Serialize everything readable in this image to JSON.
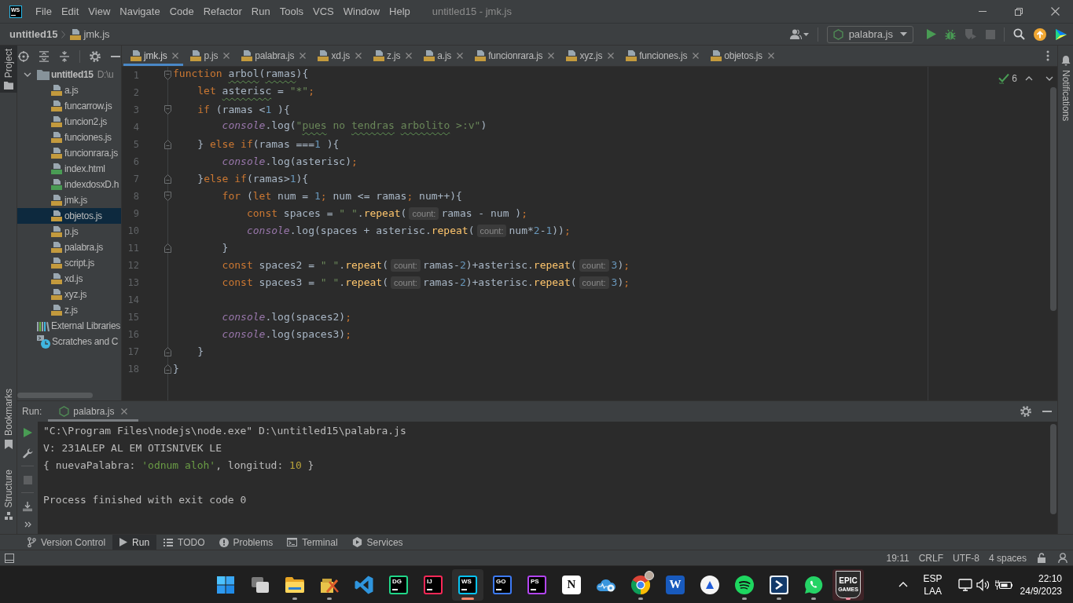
{
  "window": {
    "logo": "WS",
    "menu": [
      "File",
      "Edit",
      "View",
      "Navigate",
      "Code",
      "Refactor",
      "Run",
      "Tools",
      "VCS",
      "Window",
      "Help"
    ],
    "title": "untitled15 - jmk.js"
  },
  "navigation_bar": {
    "breadcrumbs": [
      {
        "label": "untitled15",
        "kind": "project"
      },
      {
        "label": "jmk.js",
        "kind": "js"
      }
    ],
    "run_configuration": "palabra.js"
  },
  "left_stripe": {
    "top": [
      {
        "label": "Project",
        "kind": "folder",
        "selected": true
      }
    ],
    "bottom": [
      {
        "label": "Bookmarks",
        "kind": "bookmark",
        "selected": false
      },
      {
        "label": "Structure",
        "kind": "structure",
        "selected": false
      }
    ]
  },
  "project_tree": [
    {
      "label": "untitled15",
      "path": "D:\\u",
      "kind": "folder",
      "expanded": true,
      "selected": false,
      "children": [
        {
          "label": "a.js",
          "kind": "js",
          "selected": false
        },
        {
          "label": "funcarrow.js",
          "kind": "js",
          "selected": false
        },
        {
          "label": "funcion2.js",
          "kind": "js",
          "selected": false
        },
        {
          "label": "funciones.js",
          "kind": "js",
          "selected": false
        },
        {
          "label": "funcionrara.js",
          "kind": "js",
          "selected": false
        },
        {
          "label": "index.html",
          "kind": "html",
          "selected": false
        },
        {
          "label": "indexdosxD.h",
          "kind": "html",
          "selected": false
        },
        {
          "label": "jmk.js",
          "kind": "js",
          "selected": false
        },
        {
          "label": "objetos.js",
          "kind": "js",
          "selected": true
        },
        {
          "label": "p.js",
          "kind": "js",
          "selected": false
        },
        {
          "label": "palabra.js",
          "kind": "js",
          "selected": false
        },
        {
          "label": "script.js",
          "kind": "js",
          "selected": false
        },
        {
          "label": "xd.js",
          "kind": "js",
          "selected": false
        },
        {
          "label": "xyz.js",
          "kind": "js",
          "selected": false
        },
        {
          "label": "z.js",
          "kind": "js",
          "selected": false
        }
      ]
    },
    {
      "label": "External Libraries",
      "kind": "libraries",
      "selected": false
    },
    {
      "label": "Scratches and C",
      "kind": "scratches",
      "selected": false
    }
  ],
  "editor_tabs": [
    {
      "label": "jmk.js",
      "selected": true
    },
    {
      "label": "p.js",
      "selected": false
    },
    {
      "label": "palabra.js",
      "selected": false
    },
    {
      "label": "xd.js",
      "selected": false
    },
    {
      "label": "z.js",
      "selected": false
    },
    {
      "label": "a.js",
      "selected": false
    },
    {
      "label": "funcionrara.js",
      "selected": false
    },
    {
      "label": "xyz.js",
      "selected": false
    },
    {
      "label": "funciones.js",
      "selected": false
    },
    {
      "label": "objetos.js",
      "selected": false
    }
  ],
  "editor": {
    "inspection_count": "6",
    "lines": [
      {
        "number": "1",
        "fold_start": true,
        "tokens": [
          {
            "kind": "keyword",
            "text": "function "
          },
          {
            "kind": "plain",
            "text": "arbol",
            "typo": true
          },
          {
            "kind": "plain",
            "text": "("
          },
          {
            "kind": "plain",
            "text": "ramas",
            "typo": true
          },
          {
            "kind": "plain",
            "text": "){"
          }
        ]
      },
      {
        "number": "2",
        "tokens": [
          {
            "kind": "keyword",
            "text": "    let "
          },
          {
            "kind": "plain",
            "text": "asterisc",
            "typo": true
          },
          {
            "kind": "plain",
            "text": " = "
          },
          {
            "kind": "string",
            "text": "\"*\""
          },
          {
            "kind": "keyword",
            "text": ";"
          }
        ]
      },
      {
        "number": "3",
        "fold_start": true,
        "tokens": [
          {
            "kind": "keyword",
            "text": "    if"
          },
          {
            "kind": "plain",
            "text": " (ramas <"
          },
          {
            "kind": "number",
            "text": "1"
          },
          {
            "kind": "plain",
            "text": " ){"
          }
        ]
      },
      {
        "number": "4",
        "tokens": [
          {
            "kind": "object",
            "text": "        console"
          },
          {
            "kind": "plain",
            "text": ".log("
          },
          {
            "kind": "string",
            "text": "\""
          },
          {
            "kind": "string",
            "text": "pues",
            "typo": true
          },
          {
            "kind": "string",
            "text": " no "
          },
          {
            "kind": "string",
            "text": "tendras ",
            "typo": true
          },
          {
            "kind": "string",
            "text": "arbolito",
            "typo": true
          },
          {
            "kind": "string",
            "text": " >:v\""
          },
          {
            "kind": "plain",
            "text": ")"
          }
        ]
      },
      {
        "number": "5",
        "fold_end": true,
        "tokens": [
          {
            "kind": "plain",
            "text": "    } "
          },
          {
            "kind": "keyword",
            "text": "else if"
          },
          {
            "kind": "plain",
            "text": "(ramas ==="
          },
          {
            "kind": "number",
            "text": "1"
          },
          {
            "kind": "plain",
            "text": " ){"
          }
        ]
      },
      {
        "number": "6",
        "tokens": [
          {
            "kind": "object",
            "text": "        console"
          },
          {
            "kind": "plain",
            "text": ".log(asterisc)"
          },
          {
            "kind": "keyword",
            "text": ";"
          }
        ]
      },
      {
        "number": "7",
        "fold_end": true,
        "tokens": [
          {
            "kind": "plain",
            "text": "    }"
          },
          {
            "kind": "keyword",
            "text": "else if"
          },
          {
            "kind": "plain",
            "text": "(ramas>"
          },
          {
            "kind": "number",
            "text": "1"
          },
          {
            "kind": "plain",
            "text": "){"
          }
        ]
      },
      {
        "number": "8",
        "fold_start": true,
        "tokens": [
          {
            "kind": "keyword",
            "text": "        for"
          },
          {
            "kind": "plain",
            "text": " ("
          },
          {
            "kind": "keyword",
            "text": "let"
          },
          {
            "kind": "plain",
            "text": " num = "
          },
          {
            "kind": "number",
            "text": "1"
          },
          {
            "kind": "keyword",
            "text": ";"
          },
          {
            "kind": "plain",
            "text": " num <= ramas"
          },
          {
            "kind": "keyword",
            "text": ";"
          },
          {
            "kind": "plain",
            "text": " num++){"
          }
        ]
      },
      {
        "number": "9",
        "tokens": [
          {
            "kind": "keyword",
            "text": "            const"
          },
          {
            "kind": "plain",
            "text": " spaces = "
          },
          {
            "kind": "string",
            "text": "\" \""
          },
          {
            "kind": "plain",
            "text": "."
          },
          {
            "kind": "method",
            "text": "repeat"
          },
          {
            "kind": "plain",
            "text": "("
          },
          {
            "kind": "hint",
            "text": "count:"
          },
          {
            "kind": "plain",
            "text": "ramas - num )"
          },
          {
            "kind": "keyword",
            "text": ";"
          }
        ]
      },
      {
        "number": "10",
        "tokens": [
          {
            "kind": "object",
            "text": "            console"
          },
          {
            "kind": "plain",
            "text": ".log(spaces + asterisc."
          },
          {
            "kind": "method",
            "text": "repeat"
          },
          {
            "kind": "plain",
            "text": "("
          },
          {
            "kind": "hint",
            "text": "count:"
          },
          {
            "kind": "plain",
            "text": "num*"
          },
          {
            "kind": "number",
            "text": "2"
          },
          {
            "kind": "plain",
            "text": "-"
          },
          {
            "kind": "number",
            "text": "1"
          },
          {
            "kind": "plain",
            "text": "))"
          },
          {
            "kind": "keyword",
            "text": ";"
          }
        ]
      },
      {
        "number": "11",
        "fold_end": true,
        "tokens": [
          {
            "kind": "plain",
            "text": "        }"
          }
        ]
      },
      {
        "number": "12",
        "tokens": [
          {
            "kind": "keyword",
            "text": "        const"
          },
          {
            "kind": "plain",
            "text": " spaces2 = "
          },
          {
            "kind": "string",
            "text": "\" \""
          },
          {
            "kind": "plain",
            "text": "."
          },
          {
            "kind": "method",
            "text": "repeat"
          },
          {
            "kind": "plain",
            "text": "("
          },
          {
            "kind": "hint",
            "text": "count:"
          },
          {
            "kind": "plain",
            "text": "ramas-"
          },
          {
            "kind": "number",
            "text": "2"
          },
          {
            "kind": "plain",
            "text": ")+asterisc."
          },
          {
            "kind": "method",
            "text": "repeat"
          },
          {
            "kind": "plain",
            "text": "("
          },
          {
            "kind": "hint",
            "text": "count:"
          },
          {
            "kind": "number",
            "text": "3"
          },
          {
            "kind": "plain",
            "text": ")"
          },
          {
            "kind": "keyword",
            "text": ";"
          }
        ]
      },
      {
        "number": "13",
        "tokens": [
          {
            "kind": "keyword",
            "text": "        const"
          },
          {
            "kind": "plain",
            "text": " spaces3 = "
          },
          {
            "kind": "string",
            "text": "\" \""
          },
          {
            "kind": "plain",
            "text": "."
          },
          {
            "kind": "method",
            "text": "repeat"
          },
          {
            "kind": "plain",
            "text": "("
          },
          {
            "kind": "hint",
            "text": "count:"
          },
          {
            "kind": "plain",
            "text": "ramas-"
          },
          {
            "kind": "number",
            "text": "2"
          },
          {
            "kind": "plain",
            "text": ")+asterisc."
          },
          {
            "kind": "method",
            "text": "repeat"
          },
          {
            "kind": "plain",
            "text": "("
          },
          {
            "kind": "hint",
            "text": "count:"
          },
          {
            "kind": "number",
            "text": "3"
          },
          {
            "kind": "plain",
            "text": ")"
          },
          {
            "kind": "keyword",
            "text": ";"
          }
        ]
      },
      {
        "number": "14"
      },
      {
        "number": "15",
        "tokens": [
          {
            "kind": "object",
            "text": "        console"
          },
          {
            "kind": "plain",
            "text": ".log(spaces2)"
          },
          {
            "kind": "keyword",
            "text": ";"
          }
        ]
      },
      {
        "number": "16",
        "tokens": [
          {
            "kind": "object",
            "text": "        console"
          },
          {
            "kind": "plain",
            "text": ".log(spaces3)"
          },
          {
            "kind": "keyword",
            "text": ";"
          }
        ]
      },
      {
        "number": "17",
        "fold_end": true,
        "tokens": [
          {
            "kind": "plain",
            "text": "    }"
          }
        ]
      },
      {
        "number": "18",
        "fold_end": true,
        "tokens": [
          {
            "kind": "plain",
            "text": "}"
          }
        ]
      }
    ]
  },
  "right_stripe": {
    "label": "Notifications"
  },
  "run_panel": {
    "title": "Run:",
    "tabs": [
      {
        "label": "palabra.js",
        "selected": true
      }
    ],
    "console": [
      {
        "tokens": [
          {
            "kind": "output",
            "text": "\"C:\\Program Files\\nodejs\\node.exe\" D:\\untitled15\\palabra.js"
          }
        ]
      },
      {
        "tokens": [
          {
            "kind": "output",
            "text": "V: 231ALEP AL EM OTISNIVEK LE"
          }
        ]
      },
      {
        "tokens": [
          {
            "kind": "output",
            "text": "{ nuevaPalabra: "
          },
          {
            "kind": "output-string",
            "text": "'odnum aloh'"
          },
          {
            "kind": "output",
            "text": ", longitud: "
          },
          {
            "kind": "output-number",
            "text": "10"
          },
          {
            "kind": "output",
            "text": " }"
          }
        ]
      },
      {
        "blank_line_before": true,
        "tokens": [
          {
            "kind": "output",
            "text": "Process finished with exit code 0"
          }
        ]
      }
    ]
  },
  "tool_window_bar": [
    {
      "label": "Version Control",
      "kind": "vcs",
      "selected": false
    },
    {
      "label": "Run",
      "kind": "run",
      "selected": true
    },
    {
      "label": "TODO",
      "kind": "todo",
      "selected": false
    },
    {
      "label": "Problems",
      "kind": "problems",
      "selected": false
    },
    {
      "label": "Terminal",
      "kind": "terminal",
      "selected": false
    },
    {
      "label": "Services",
      "kind": "services",
      "selected": false
    }
  ],
  "status_bar": [
    "19:11",
    "CRLF",
    "UTF-8",
    "4 spaces"
  ],
  "taskbar": {
    "apps": [
      {
        "kind": "start",
        "running": false,
        "active": false
      },
      {
        "kind": "task-view",
        "running": false,
        "active": false
      },
      {
        "kind": "folder",
        "running": true,
        "active": false
      },
      {
        "kind": "tools",
        "running": true,
        "active": false
      },
      {
        "kind": "ribbon",
        "running": false,
        "active": false
      },
      {
        "kind": "framed-tile",
        "text": "DG",
        "color": "#21d789",
        "running": false,
        "active": false
      },
      {
        "kind": "framed-tile",
        "text": "IJ",
        "color": "#fe2857",
        "running": false,
        "active": false
      },
      {
        "kind": "framed-tile",
        "text": "WS",
        "color": "#07c3f2",
        "running": true,
        "active": true
      },
      {
        "kind": "framed-tile",
        "text": "GO",
        "color": "#3d7bf7",
        "running": false,
        "active": false
      },
      {
        "kind": "framed-tile",
        "text": "PS",
        "color": "#b345f1",
        "running": false,
        "active": false
      },
      {
        "kind": "plain-tile",
        "text": "N",
        "color": "#ffffff",
        "running": false,
        "active": false
      },
      {
        "kind": "cloud",
        "running": false,
        "active": false
      },
      {
        "kind": "browser",
        "running": true,
        "active": false
      },
      {
        "kind": "plain-tile",
        "text": "W",
        "color": "#185abd",
        "running": false,
        "active": false
      },
      {
        "kind": "circle",
        "running": false,
        "active": false
      },
      {
        "kind": "music",
        "running": true,
        "active": false
      },
      {
        "kind": "arrow",
        "running": true,
        "active": false
      },
      {
        "kind": "chat",
        "running": true,
        "active": false
      },
      {
        "kind": "shield-tile",
        "text": "EPIC",
        "subtext": "GAMES",
        "running": true,
        "active": false,
        "attention": true
      }
    ],
    "language": [
      "ESP",
      "LAA"
    ],
    "time": "22:10",
    "date": "24/9/2023"
  }
}
